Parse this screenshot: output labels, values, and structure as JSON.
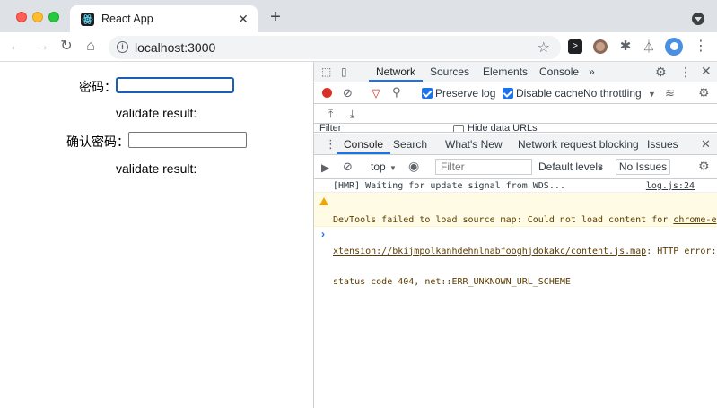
{
  "browser": {
    "tab_title": "React App",
    "tab_close": "✕",
    "new_tab": "+",
    "url": "localhost:3000"
  },
  "form": {
    "password_label": "密码：",
    "confirm_label": "确认密码：",
    "password_value": "",
    "confirm_value": "",
    "result_label_1": "validate result:",
    "result_label_2": "validate result:"
  },
  "devtools": {
    "tabs": [
      "Network",
      "Sources",
      "Elements",
      "Console"
    ],
    "active_tab": "Network",
    "more_tabs": "»",
    "preserve_log": {
      "label": "Preserve log",
      "checked": true
    },
    "disable_cache": {
      "label": "Disable cache",
      "checked": true
    },
    "throttling": "No throttling",
    "filter_partial": "Filter",
    "hide_data_urls": {
      "label": "Hide data URLs",
      "checked": false
    },
    "drawer_tabs": [
      "Console",
      "Search",
      "What's New",
      "Network request blocking",
      "Issues"
    ],
    "drawer_active": "Console",
    "context": "top",
    "console_filter_placeholder": "Filter",
    "levels": "Default levels",
    "issues_button": "No Issues",
    "messages": {
      "log_text": "[HMR] Waiting for update signal from WDS...",
      "log_source": "log.js:24",
      "warn_line1_a": "DevTools failed to load source map: Could not load content for ",
      "warn_line1_b": "chrome-e",
      "warn_line2_link": "xtension://bkijmpolkanhdehnlnabfooghjdokakc/content.js.map",
      "warn_line2_rest": ": HTTP error:",
      "warn_line3": "status code 404, net::ERR_UNKNOWN_URL_SCHEME"
    },
    "prompt": "›"
  },
  "colors": {
    "accent": "#1a73e8",
    "warning_bg": "#fffbe5",
    "record": "#d93025"
  }
}
